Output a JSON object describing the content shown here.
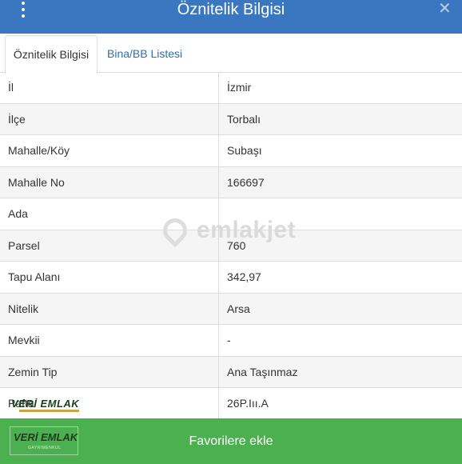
{
  "header": {
    "title": "Öznitelik Bilgisi",
    "menu_icon": "more-vertical-icon",
    "close_icon": "close-icon",
    "close_glyph": "✕",
    "background": "#3a77c0"
  },
  "tabs": [
    {
      "label": "Öznitelik Bilgisi",
      "active": true
    },
    {
      "label": "Bina/BB Listesi",
      "active": false
    }
  ],
  "table": {
    "rows": [
      {
        "key": "İl",
        "value": "İzmir"
      },
      {
        "key": "İlçe",
        "value": "Torbalı"
      },
      {
        "key": "Mahalle/Köy",
        "value": "Subaşı"
      },
      {
        "key": "Mahalle No",
        "value": "166697"
      },
      {
        "key": "Ada",
        "value": ""
      },
      {
        "key": "Parsel",
        "value": "760"
      },
      {
        "key": "Tapu Alanı",
        "value": "342,97"
      },
      {
        "key": "Nitelik",
        "value": "Arsa"
      },
      {
        "key": "Mevkii",
        "value": "-"
      },
      {
        "key": "Zemin Tip",
        "value": "Ana Taşınmaz"
      },
      {
        "key": "Pafta",
        "value": "26P.Iıı.A"
      }
    ]
  },
  "watermark": {
    "text": "emlakjet",
    "icon": "location-pin-icon"
  },
  "stamp": {
    "text": "VERİ EMLAK"
  },
  "footer": {
    "button_label": "Favorilere ekle",
    "logo_text": "VERİ EMLAK",
    "logo_subtext": "GAYRIMENKUL",
    "background": "#4caf50"
  }
}
